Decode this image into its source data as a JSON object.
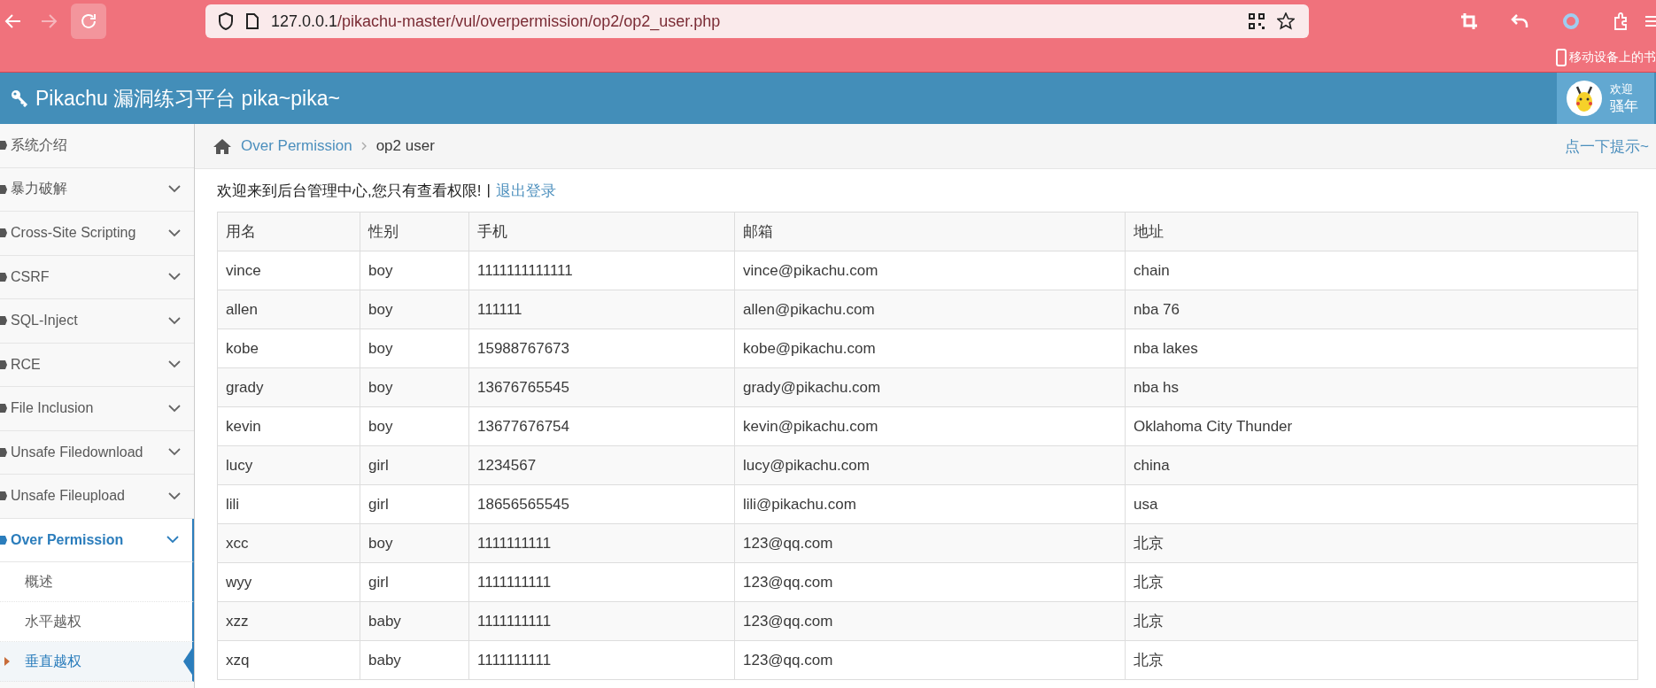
{
  "browser": {
    "url_host": "127.0.0.1",
    "url_path": "/pikachu-master/vul/overpermission/op2/op2_user.php",
    "bookmark": "移动设备上的书"
  },
  "header": {
    "title": "Pikachu 漏洞练习平台 pika~pika~",
    "welcome": "欢迎",
    "user": "骚年"
  },
  "sidebar": {
    "items": [
      {
        "label": "系统介绍",
        "kind": "link",
        "selected": false
      },
      {
        "label": "暴力破解",
        "kind": "menu",
        "selected": false
      },
      {
        "label": "Cross-Site Scripting",
        "kind": "menu",
        "selected": false
      },
      {
        "label": "CSRF",
        "kind": "menu",
        "selected": false
      },
      {
        "label": "SQL-Inject",
        "kind": "menu",
        "selected": false
      },
      {
        "label": "RCE",
        "kind": "menu",
        "selected": false
      },
      {
        "label": "File Inclusion",
        "kind": "menu",
        "selected": false
      },
      {
        "label": "Unsafe Filedownload",
        "kind": "menu",
        "selected": false
      },
      {
        "label": "Unsafe Fileupload",
        "kind": "menu",
        "selected": false
      },
      {
        "label": "Over Permission",
        "kind": "menu",
        "selected": true,
        "children": [
          {
            "label": "概述",
            "selected": false
          },
          {
            "label": "水平越权",
            "selected": false
          },
          {
            "label": "垂直越权",
            "selected": true
          }
        ]
      }
    ]
  },
  "breadcrumb": {
    "items": [
      "Over Permission",
      "op2 user"
    ],
    "hint": "点一下提示~"
  },
  "content": {
    "notice": "欢迎来到后台管理中心,您只有查看权限!",
    "separator": "|",
    "logout": "退出登录"
  },
  "table": {
    "columns": [
      "用名",
      "性别",
      "手机",
      "邮箱",
      "地址"
    ],
    "rows": [
      [
        "vince",
        "boy",
        "1111111111111",
        "vince@pikachu.com",
        "chain"
      ],
      [
        "allen",
        "boy",
        "111111",
        "allen@pikachu.com",
        "nba 76"
      ],
      [
        "kobe",
        "boy",
        "15988767673",
        "kobe@pikachu.com",
        "nba lakes"
      ],
      [
        "grady",
        "boy",
        "13676765545",
        "grady@pikachu.com",
        "nba hs"
      ],
      [
        "kevin",
        "boy",
        "13677676754",
        "kevin@pikachu.com",
        "Oklahoma City Thunder"
      ],
      [
        "lucy",
        "girl",
        "1234567",
        "lucy@pikachu.com",
        "china"
      ],
      [
        "lili",
        "girl",
        "18656565545",
        "lili@pikachu.com",
        "usa"
      ],
      [
        "xcc",
        "boy",
        "1111111111",
        "123@qq.com",
        "北京"
      ],
      [
        "wyy",
        "girl",
        "1111111111",
        "123@qq.com",
        "北京"
      ],
      [
        "xzz",
        "baby",
        "1111111111",
        "123@qq.com",
        "北京"
      ],
      [
        "xzq",
        "baby",
        "1111111111",
        "123@qq.com",
        "北京"
      ]
    ]
  }
}
